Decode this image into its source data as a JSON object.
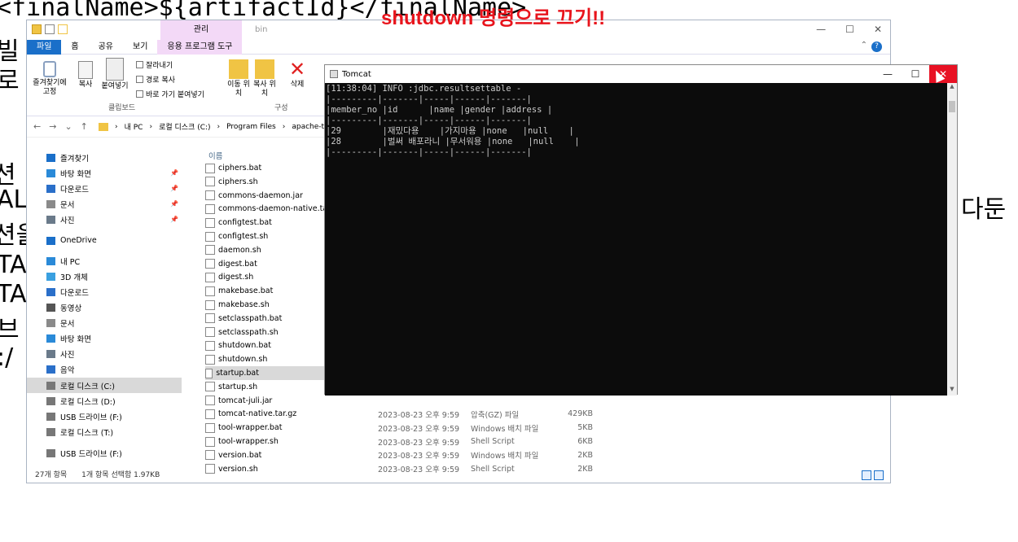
{
  "overlay": {
    "title": "shutdown 명령으로 끄기!!",
    "bg_code_top": "<finalName>${artifactId}</finalName>",
    "bg_left_glyphs": [
      "빌",
      "로",
      "",
      "",
      "",
      "션",
      "AL",
      "션을",
      "TA",
      "TA",
      "브",
      ":/"
    ],
    "bg_right_text": "다둔"
  },
  "explorer": {
    "title_tab": "관리",
    "folder_name": "bin",
    "window_buttons": [
      "—",
      "☐",
      "✕"
    ],
    "ribbon_tabs": [
      "파일",
      "홈",
      "공유",
      "보기",
      "응용 프로그램 도구"
    ],
    "ribbon": {
      "pin_label": "즐겨찾기에 고정",
      "copy_label": "복사",
      "paste_label": "붙여넣기",
      "cut_label": "잘라내기",
      "copy_path_label": "경로 복사",
      "paste_shortcut_label": "바로 가기 붙여넣기",
      "clipboard_group": "클립보드",
      "move_label": "이동 위치",
      "copy_to_label": "복사 위치",
      "delete_label": "삭제",
      "organize_group": "구성"
    },
    "address": {
      "crumbs": [
        "내 PC",
        "로컬 디스크 (C:)",
        "Program Files",
        "apache-to"
      ]
    },
    "nav": [
      {
        "label": "즐겨찾기",
        "icon": "star-icon",
        "color": "#1a6fc9"
      },
      {
        "label": "바탕 화면",
        "icon": "desktop-icon",
        "color": "#2a8ad8",
        "pinned": true
      },
      {
        "label": "다운로드",
        "icon": "download-icon",
        "color": "#2a6fc9",
        "pinned": true
      },
      {
        "label": "문서",
        "icon": "document-icon",
        "color": "#8a8a8a",
        "pinned": true
      },
      {
        "label": "사진",
        "icon": "picture-icon",
        "color": "#6a7a8a",
        "pinned": true
      },
      {
        "label": "OneDrive",
        "icon": "cloud-icon",
        "color": "#1a6fc9"
      },
      {
        "label": "내 PC",
        "icon": "pc-icon",
        "color": "#2a8ad8"
      },
      {
        "label": "3D 개체",
        "icon": "cube-icon",
        "color": "#3aa0e0"
      },
      {
        "label": "다운로드",
        "icon": "download-icon",
        "color": "#2a6fc9"
      },
      {
        "label": "동영상",
        "icon": "video-icon",
        "color": "#555555"
      },
      {
        "label": "문서",
        "icon": "document-icon",
        "color": "#8a8a8a"
      },
      {
        "label": "바탕 화면",
        "icon": "desktop-icon",
        "color": "#2a8ad8"
      },
      {
        "label": "사진",
        "icon": "picture-icon",
        "color": "#6a7a8a"
      },
      {
        "label": "음악",
        "icon": "music-icon",
        "color": "#2a6fc9"
      },
      {
        "label": "로컬 디스크 (C:)",
        "icon": "drive-icon",
        "color": "#777777",
        "selected": true
      },
      {
        "label": "로컬 디스크 (D:)",
        "icon": "drive-icon",
        "color": "#777777"
      },
      {
        "label": "USB 드라이브 (F:)",
        "icon": "usb-icon",
        "color": "#777777"
      },
      {
        "label": "로컬 디스크 (T:)",
        "icon": "drive-icon",
        "color": "#777777"
      },
      {
        "label": "USB 드라이브 (F:)",
        "icon": "usb-icon",
        "color": "#777777"
      }
    ],
    "files_header": "이름",
    "files": [
      {
        "name": "ciphers.bat",
        "date": "",
        "type": "",
        "size": ""
      },
      {
        "name": "ciphers.sh",
        "date": "",
        "type": "",
        "size": ""
      },
      {
        "name": "commons-daemon.jar",
        "date": "",
        "type": "",
        "size": ""
      },
      {
        "name": "commons-daemon-native.tar.g",
        "date": "",
        "type": "",
        "size": ""
      },
      {
        "name": "configtest.bat",
        "date": "",
        "type": "",
        "size": ""
      },
      {
        "name": "configtest.sh",
        "date": "",
        "type": "",
        "size": ""
      },
      {
        "name": "daemon.sh",
        "date": "",
        "type": "",
        "size": ""
      },
      {
        "name": "digest.bat",
        "date": "",
        "type": "",
        "size": ""
      },
      {
        "name": "digest.sh",
        "date": "",
        "type": "",
        "size": ""
      },
      {
        "name": "makebase.bat",
        "date": "",
        "type": "",
        "size": ""
      },
      {
        "name": "makebase.sh",
        "date": "",
        "type": "",
        "size": ""
      },
      {
        "name": "setclasspath.bat",
        "date": "",
        "type": "",
        "size": ""
      },
      {
        "name": "setclasspath.sh",
        "date": "",
        "type": "",
        "size": ""
      },
      {
        "name": "shutdown.bat",
        "date": "",
        "type": "",
        "size": ""
      },
      {
        "name": "shutdown.sh",
        "date": "",
        "type": "",
        "size": ""
      },
      {
        "name": "startup.bat",
        "date": "",
        "type": "",
        "size": "",
        "selected": true
      },
      {
        "name": "startup.sh",
        "date": "",
        "type": "",
        "size": ""
      },
      {
        "name": "tomcat-juli.jar",
        "date": "",
        "type": "",
        "size": ""
      },
      {
        "name": "tomcat-native.tar.gz",
        "date": "2023-08-23 오후 9:59",
        "type": "압축(GZ) 파일",
        "size": "429KB"
      },
      {
        "name": "tool-wrapper.bat",
        "date": "2023-08-23 오후 9:59",
        "type": "Windows 배치 파일",
        "size": "5KB"
      },
      {
        "name": "tool-wrapper.sh",
        "date": "2023-08-23 오후 9:59",
        "type": "Shell Script",
        "size": "6KB"
      },
      {
        "name": "version.bat",
        "date": "2023-08-23 오후 9:59",
        "type": "Windows 배치 파일",
        "size": "2KB"
      },
      {
        "name": "version.sh",
        "date": "2023-08-23 오후 9:59",
        "type": "Shell Script",
        "size": "2KB"
      }
    ],
    "status": {
      "count": "27개 항목",
      "selection": "1개 항목 선택함 1.97KB"
    }
  },
  "tomcat": {
    "title": "Tomcat",
    "buttons": [
      "—",
      "☐",
      "✕"
    ],
    "console_lines": [
      "[11:38:04] INFO :jdbc.resultsettable -",
      "|---------|-------|-----|------|-------|",
      "|member_no |id      |name |gender |address |",
      "|---------|-------|-----|------|-------|",
      "|29        |재밌다용    |가지마용 |none   |null    |",
      "|28        |벌써 배포라니 |무서워용 |none   |null    |",
      "|---------|-------|-----|------|-------|"
    ]
  }
}
